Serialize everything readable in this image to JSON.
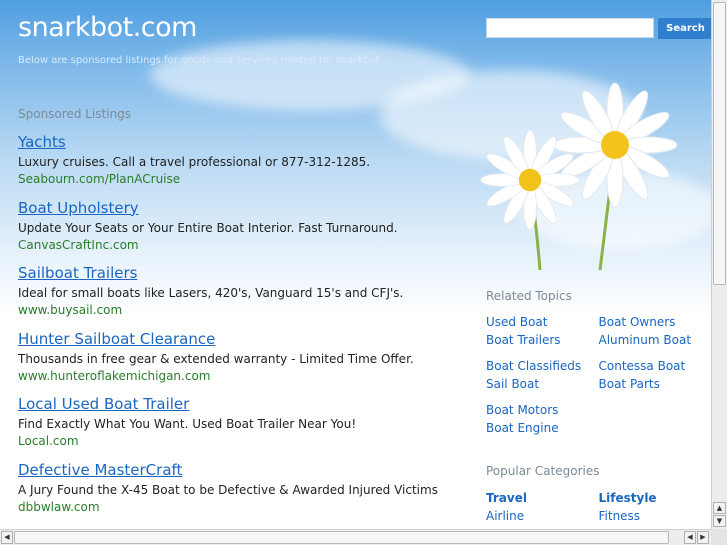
{
  "header": {
    "logo": "snarkbot.com",
    "tagline": "Below are sponsored listings for goods and services related to: snarkbot"
  },
  "search": {
    "value": "",
    "button_label": "Search"
  },
  "sponsored": {
    "heading": "Sponsored Listings",
    "listings": [
      {
        "title": "Yachts",
        "description": "Luxury cruises. Call a travel professional or 877-312-1285.",
        "url": "Seabourn.com/PlanACruise"
      },
      {
        "title": "Boat Upholstery",
        "description": "Update Your Seats or Your Entire Boat Interior. Fast Turnaround.",
        "url": "CanvasCraftInc.com"
      },
      {
        "title": "Sailboat Trailers",
        "description": "Ideal for small boats like Lasers, 420's, Vanguard 15's and CFJ's.",
        "url": "www.buysail.com"
      },
      {
        "title": "Hunter Sailboat Clearance",
        "description": "Thousands in free gear & extended warranty - Limited Time Offer.",
        "url": "www.hunteroflakemichigan.com"
      },
      {
        "title": "Local Used Boat Trailer",
        "description": "Find Exactly What You Want. Used Boat Trailer Near You!",
        "url": "Local.com"
      },
      {
        "title": "Defective MasterCraft",
        "description": "A Jury Found the X-45 Boat to be Defective & Awarded Injured Victims",
        "url": "dbbwlaw.com"
      }
    ]
  },
  "related": {
    "heading": "Related Topics",
    "groups": [
      {
        "left": [
          "Used Boat",
          "Boat Trailers"
        ],
        "right": [
          "Boat Owners",
          "Aluminum Boat"
        ]
      },
      {
        "left": [
          "Boat Classifieds",
          "Sail Boat"
        ],
        "right": [
          "Contessa Boat",
          "Boat Parts"
        ]
      },
      {
        "left": [
          "Boat Motors",
          "Boat Engine"
        ],
        "right": []
      }
    ]
  },
  "popular": {
    "heading": "Popular Categories",
    "columns": [
      {
        "title": "Travel",
        "links": [
          "Airline"
        ]
      },
      {
        "title": "Lifestyle",
        "links": [
          "Fitness"
        ]
      }
    ]
  }
}
